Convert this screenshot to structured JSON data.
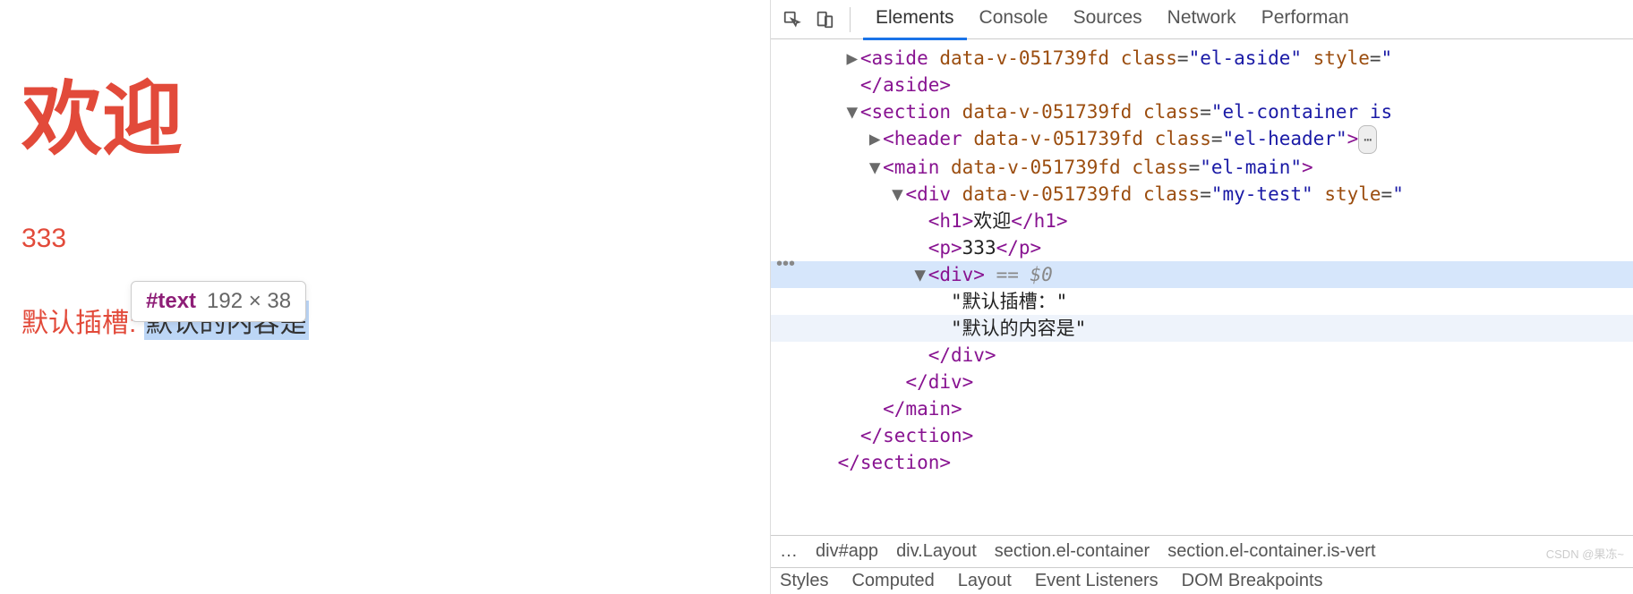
{
  "page": {
    "heading": "欢迎",
    "number": "333",
    "slot_label": "默认插槽:",
    "slot_value": "默认的内容是"
  },
  "tooltip": {
    "name": "#text",
    "dims": "192 × 38"
  },
  "devtools": {
    "tabs": [
      "Elements",
      "Console",
      "Sources",
      "Network",
      "Performan"
    ],
    "active_tab": 0,
    "dom_lines": [
      {
        "indent": 3,
        "tri": "▶",
        "html": "<aside data-v-051739fd class=\"el-aside\" style=\""
      },
      {
        "indent": 3,
        "tri": " ",
        "close": "</aside>"
      },
      {
        "indent": 3,
        "tri": "▼",
        "html": "<section data-v-051739fd class=\"el-container is"
      },
      {
        "indent": 4,
        "tri": "▶",
        "html": "<header data-v-051739fd class=\"el-header\">",
        "badge": true
      },
      {
        "indent": 4,
        "tri": "▼",
        "html": "<main data-v-051739fd class=\"el-main\">"
      },
      {
        "indent": 5,
        "tri": "▼",
        "html": "<div data-v-051739fd class=\"my-test\" style=\""
      },
      {
        "indent": 6,
        "tri": " ",
        "inline": {
          "tag": "h1",
          "text": "欢迎"
        }
      },
      {
        "indent": 6,
        "tri": " ",
        "inline": {
          "tag": "p",
          "text": "333"
        }
      },
      {
        "indent": 6,
        "tri": "▼",
        "html": "<div>",
        "suffix": " == $0",
        "sel": true
      },
      {
        "indent": 7,
        "tri": " ",
        "text": "\"默认插槽：\""
      },
      {
        "indent": 7,
        "tri": " ",
        "text": "\"默认的内容是\"",
        "hov": true
      },
      {
        "indent": 6,
        "tri": " ",
        "close": "</div>"
      },
      {
        "indent": 5,
        "tri": " ",
        "close": "</div>"
      },
      {
        "indent": 4,
        "tri": " ",
        "close": "</main>"
      },
      {
        "indent": 3,
        "tri": " ",
        "close": "</section>"
      },
      {
        "indent": 2,
        "tri": " ",
        "close": "</section>"
      }
    ],
    "breadcrumbs": [
      "…",
      "div#app",
      "div.Layout",
      "section.el-container",
      "section.el-container.is-vert"
    ],
    "subtabs": [
      "Styles",
      "Computed",
      "Layout",
      "Event Listeners",
      "DOM Breakpoints"
    ]
  },
  "watermark": "CSDN @果冻~"
}
